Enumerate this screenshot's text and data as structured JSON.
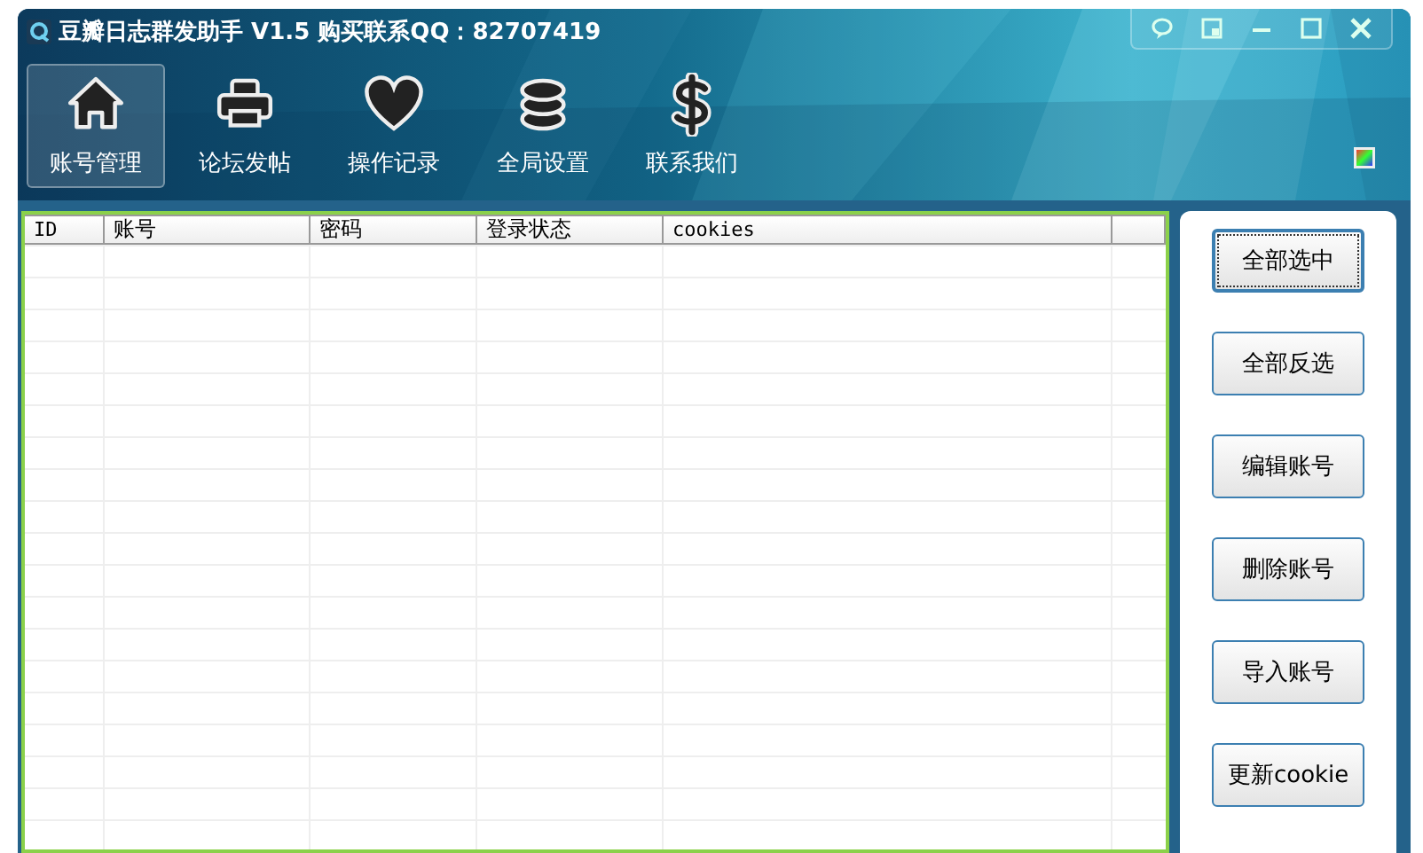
{
  "window": {
    "title": "豆瓣日志群发助手 V1.5 购买联系QQ：82707419"
  },
  "toolbar": [
    {
      "label": "账号管理",
      "selected": true
    },
    {
      "label": "论坛发帖",
      "selected": false
    },
    {
      "label": "操作记录",
      "selected": false
    },
    {
      "label": "全局设置",
      "selected": false
    },
    {
      "label": "联系我们",
      "selected": false
    }
  ],
  "table": {
    "columns": [
      "ID",
      "账号",
      "密码",
      "登录状态",
      "cookies"
    ]
  },
  "buttons": [
    {
      "label": "全部选中",
      "focused": true
    },
    {
      "label": "全部反选",
      "focused": false
    },
    {
      "label": "编辑账号",
      "focused": false
    },
    {
      "label": "删除账号",
      "focused": false
    },
    {
      "label": "导入账号",
      "focused": false
    },
    {
      "label": "更新cookie",
      "focused": false
    }
  ]
}
